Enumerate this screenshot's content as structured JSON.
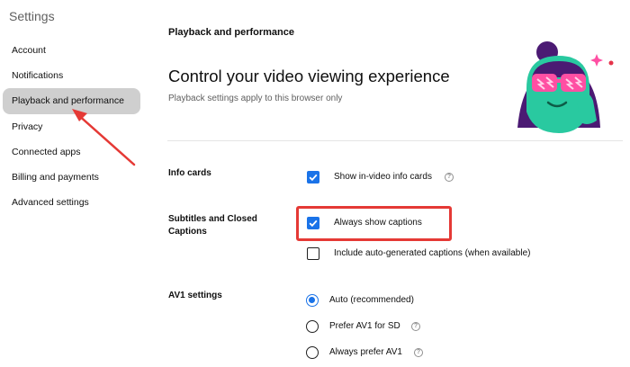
{
  "sidebar": {
    "title": "Settings",
    "items": [
      {
        "label": "Account"
      },
      {
        "label": "Notifications"
      },
      {
        "label": "Playback and performance"
      },
      {
        "label": "Privacy"
      },
      {
        "label": "Connected apps"
      },
      {
        "label": "Billing and payments"
      },
      {
        "label": "Advanced settings"
      }
    ]
  },
  "main": {
    "section_heading": "Playback and performance",
    "title": "Control your video viewing experience",
    "subtitle": "Playback settings apply to this browser only",
    "info_cards": {
      "label": "Info cards",
      "option": "Show in-video info cards",
      "checked": true
    },
    "subtitles": {
      "label": "Subtitles and Closed Captions",
      "options": [
        {
          "label": "Always show captions",
          "checked": true
        },
        {
          "label": "Include auto-generated captions (when available)",
          "checked": false
        }
      ]
    },
    "av1": {
      "label": "AV1 settings",
      "options": [
        {
          "label": "Auto (recommended)",
          "selected": true
        },
        {
          "label": "Prefer AV1 for SD",
          "selected": false
        },
        {
          "label": "Always prefer AV1",
          "selected": false
        }
      ]
    },
    "help_glyph": "?"
  },
  "colors": {
    "accent": "#1a73e8",
    "annotation": "#e53935",
    "active_nav": "#cfcfcf"
  }
}
